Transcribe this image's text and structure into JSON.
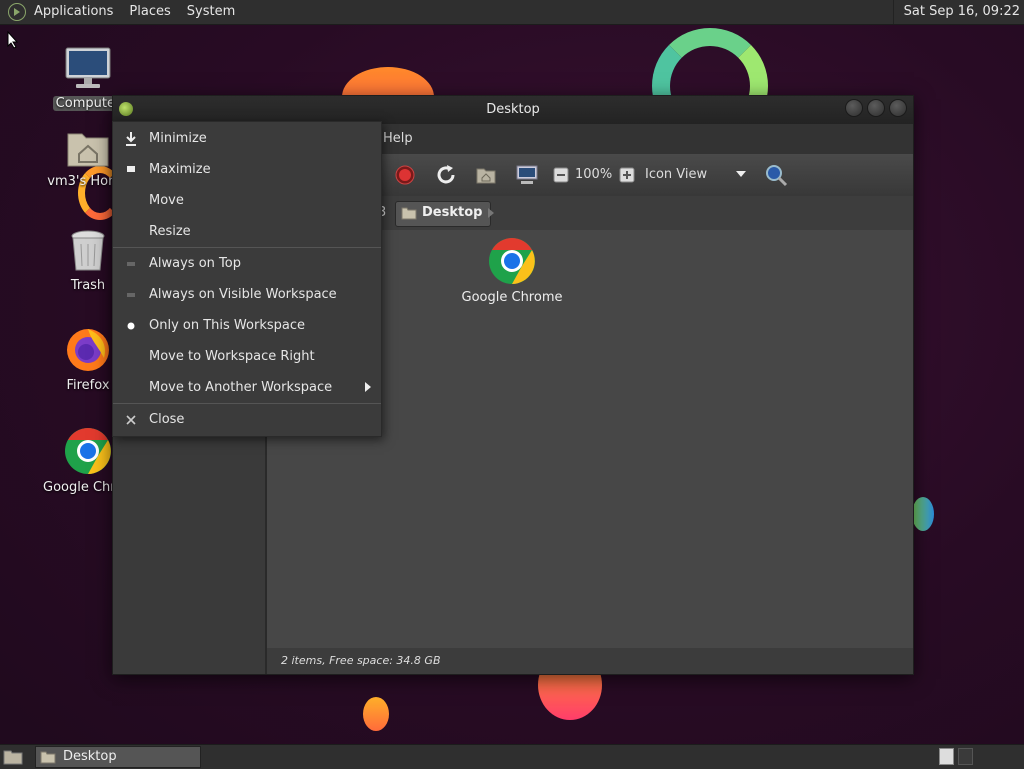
{
  "top_panel": {
    "menus": [
      "Applications",
      "Places",
      "System"
    ],
    "clock": "Sat Sep 16, 09:22"
  },
  "desktop_icons": [
    {
      "label": "Computer",
      "icon": "computer-icon"
    },
    {
      "label": "vm3's Home",
      "icon": "home-folder-icon"
    },
    {
      "label": "Trash",
      "icon": "trash-icon"
    },
    {
      "label": "Firefox",
      "icon": "firefox-icon"
    },
    {
      "label": "Google Chrome",
      "icon": "chrome-icon"
    }
  ],
  "window": {
    "title": "Desktop",
    "menubar": {
      "help": "Help"
    },
    "toolbar": {
      "zoom": "100%",
      "view_mode": "Icon View"
    },
    "pathbar": {
      "prev_fragment": "3",
      "current": "Desktop"
    },
    "files": [
      {
        "label": "Google Chrome",
        "icon": "chrome-icon"
      }
    ],
    "status": "2 items, Free space: 34.8 GB"
  },
  "context_menu": {
    "items": [
      {
        "label": "Minimize",
        "icon": "minimize-icon"
      },
      {
        "label": "Maximize",
        "icon": "maximize-icon"
      },
      {
        "label": "Move"
      },
      {
        "label": "Resize"
      },
      {
        "label": "Always on Top"
      },
      {
        "label": "Always on Visible Workspace"
      },
      {
        "label": "Only on This Workspace",
        "selected": true
      },
      {
        "label": "Move to Workspace Right"
      },
      {
        "label": "Move to Another Workspace",
        "submenu": true
      },
      {
        "label": "Close",
        "icon": "close-icon"
      }
    ]
  },
  "bottom_panel": {
    "task_label": "Desktop"
  },
  "colors": {
    "desktop_bg": "#2a0d26",
    "panel_bg": "#2f2f2f",
    "window_bg": "#3a3a3a",
    "content_bg": "#474747",
    "menu_bg": "#3b3b3b"
  }
}
